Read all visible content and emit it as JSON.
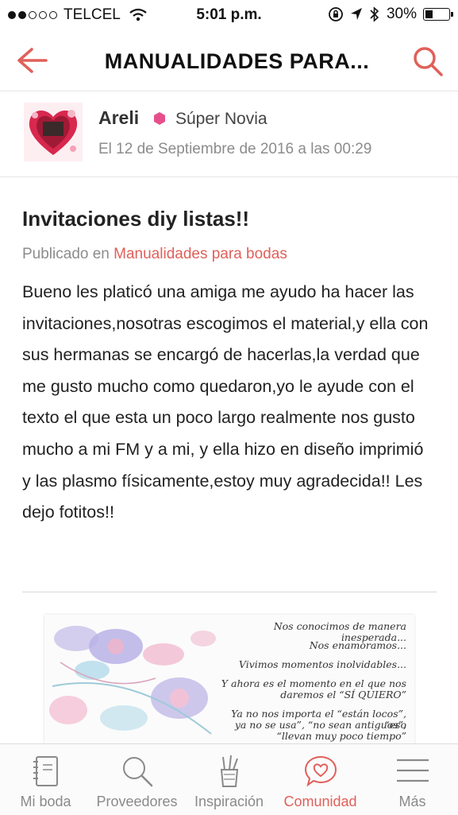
{
  "status_bar": {
    "carrier": "TELCEL",
    "time": "5:01 p.m.",
    "battery": "30%",
    "battery_level": 0.3
  },
  "nav": {
    "title": "MANUALIDADES PARA...",
    "back_icon": "back-arrow-icon",
    "search_icon": "search-icon"
  },
  "author": {
    "name": "Areli",
    "badge": "Súper Novia",
    "date": "El 12 de Septiembre de 2016 a las 00:29"
  },
  "post": {
    "title": "Invitaciones diy listas!!",
    "published_prefix": "Publicado en",
    "category": "Manualidades para bodas",
    "body": "Bueno les platicó una amiga me ayudo ha hacer las invitaciones,nosotras escogimos el material,y ella con sus hermanas se encargó de hacerlas,la verdad que me gusto mucho como quedaron,yo le ayude con el texto el que esta un poco largo realmente nos gusto mucho a mi FM y a mi, y ella hizo en diseño imprimió y las plasmo físicamente,estoy muy agradecida!! Les dejo fotitos!!"
  },
  "invitation": {
    "lines": [
      "Nos conocimos de manera inesperada...",
      "Nos enamoramos...",
      "Vivimos momentos inolvidables...",
      "Y ahora es el momento en el que nos",
      "daremos el “SÍ QUIERO”",
      "Ya no nos importa el “están locos”, “eso",
      "ya no se usa”, “no sean antiguos”,",
      "“llevan muy poco tiempo”"
    ]
  },
  "tabbar": {
    "tabs": [
      {
        "label": "Mi boda",
        "icon": "notebook-icon"
      },
      {
        "label": "Proveedores",
        "icon": "search-icon"
      },
      {
        "label": "Inspiración",
        "icon": "pencil-cup-icon"
      },
      {
        "label": "Comunidad",
        "icon": "heart-chat-icon"
      },
      {
        "label": "Más",
        "icon": "menu-icon"
      }
    ],
    "active_tab": "Comunidad"
  },
  "colors": {
    "accent": "#e0605a",
    "badge": "#e64f8a",
    "muted_text": "#8c8c8c"
  }
}
